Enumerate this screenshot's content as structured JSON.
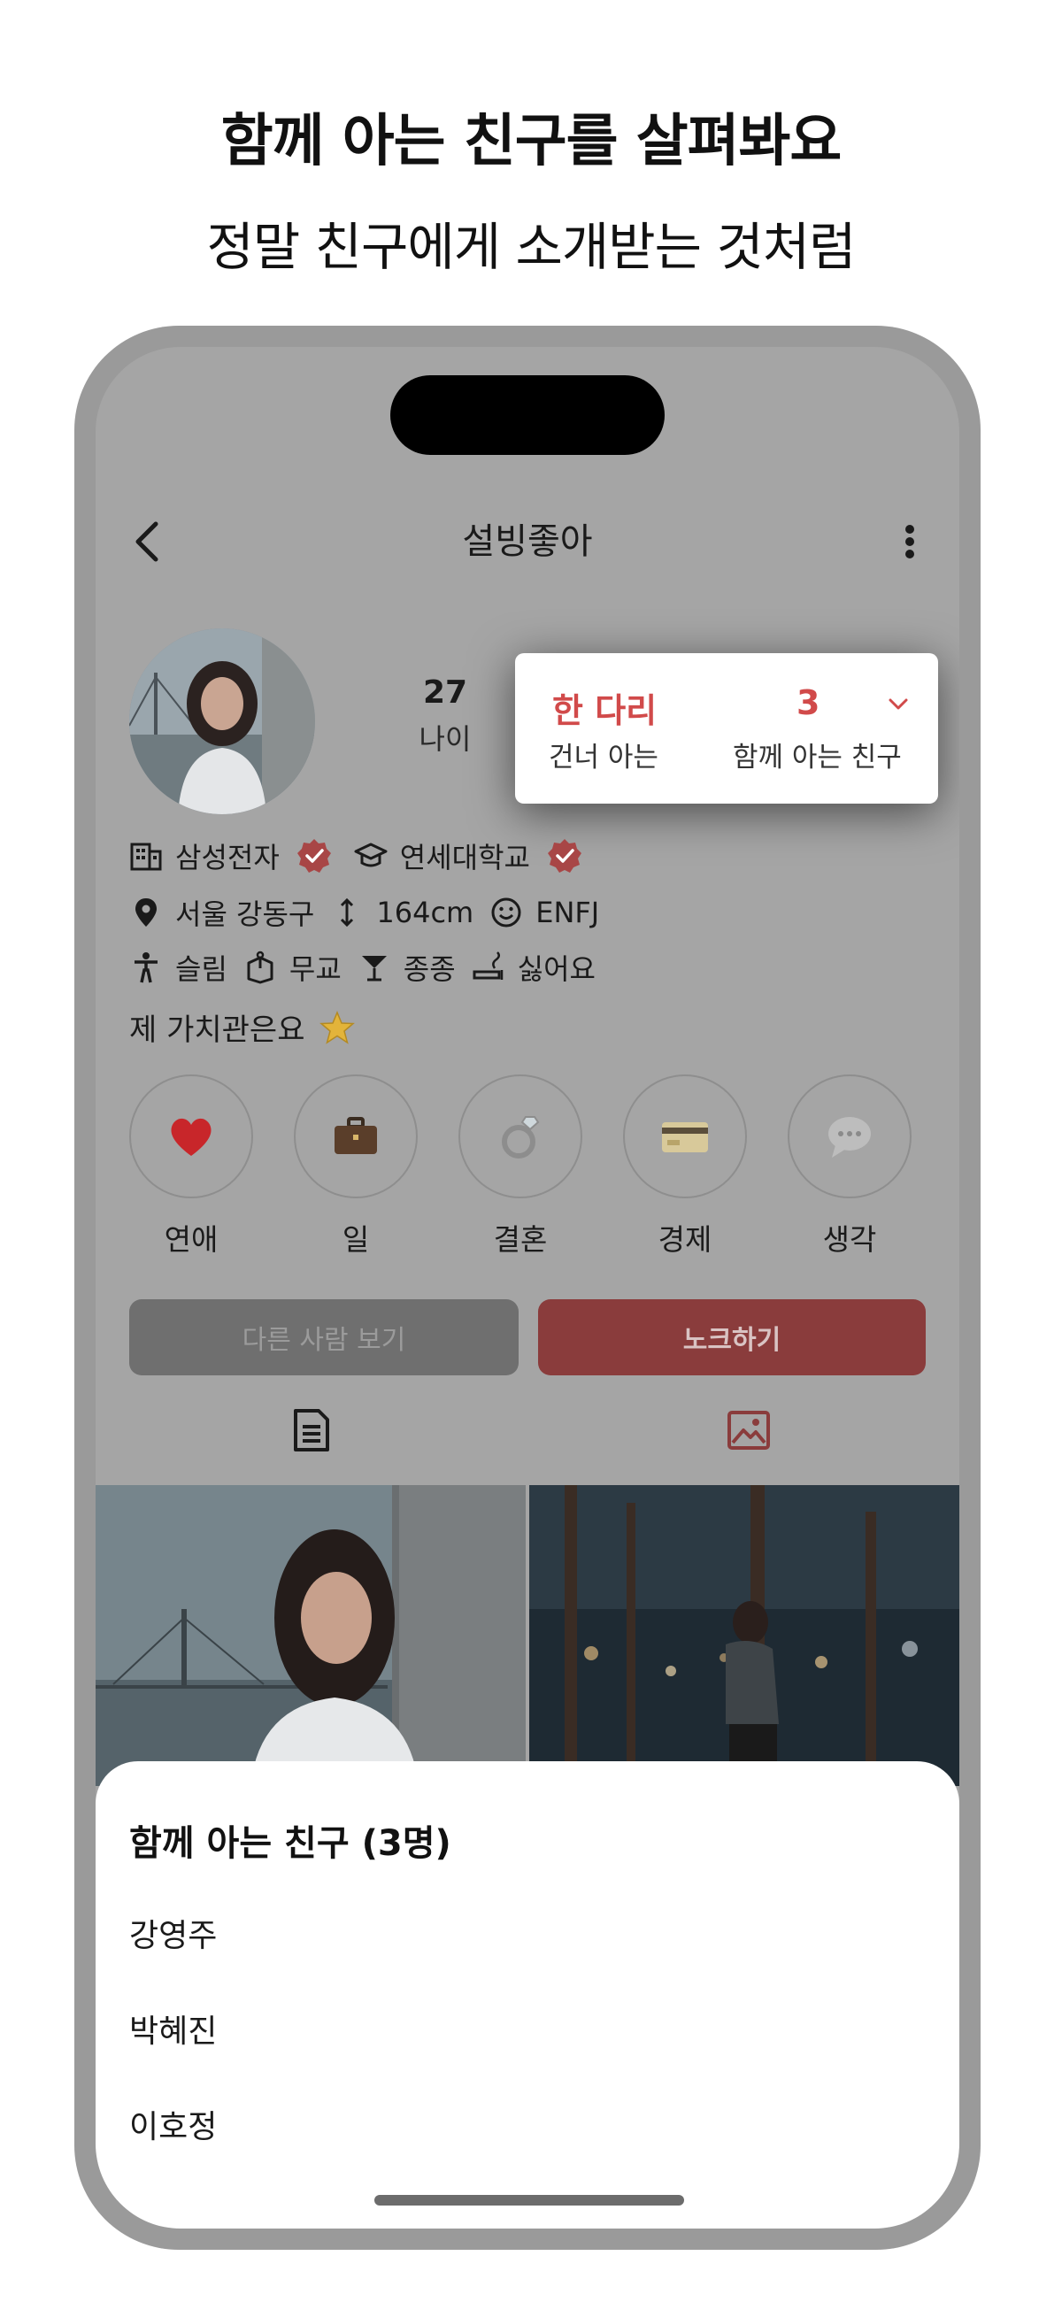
{
  "headline": "함께 아는 친구를 살펴봐요",
  "subline": "정말 친구에게 소개받는 것처럼",
  "nav": {
    "title": "설빙좋아"
  },
  "profile": {
    "age_value": "27",
    "age_label": "나이"
  },
  "popup": {
    "degree_value": "한 다리",
    "degree_label": "건너 아는",
    "mutual_value": "3",
    "mutual_label": "함께 아는 친구"
  },
  "info": {
    "company": "삼성전자",
    "school": "연세대학교",
    "location": "서울 강동구",
    "height": "164cm",
    "mbti": "ENFJ",
    "body": "슬림",
    "religion": "무교",
    "drinking": "종종",
    "smoking": "싫어요"
  },
  "values": {
    "title": "제 가치관은요",
    "items": [
      {
        "label": "연애",
        "icon": "heart-icon"
      },
      {
        "label": "일",
        "icon": "briefcase-icon"
      },
      {
        "label": "결혼",
        "icon": "ring-icon"
      },
      {
        "label": "경제",
        "icon": "credit-card-icon"
      },
      {
        "label": "생각",
        "icon": "speech-bubble-icon"
      }
    ]
  },
  "buttons": {
    "other": "다른 사람 보기",
    "knock": "노크하기"
  },
  "sheet": {
    "title": "함께 아는 친구 (3명)",
    "friends": [
      "강영주",
      "박혜진",
      "이호정"
    ]
  },
  "colors": {
    "accent": "#d14a4a",
    "knock_button": "#8a3c3c",
    "overlay": "#a5a5a5"
  }
}
